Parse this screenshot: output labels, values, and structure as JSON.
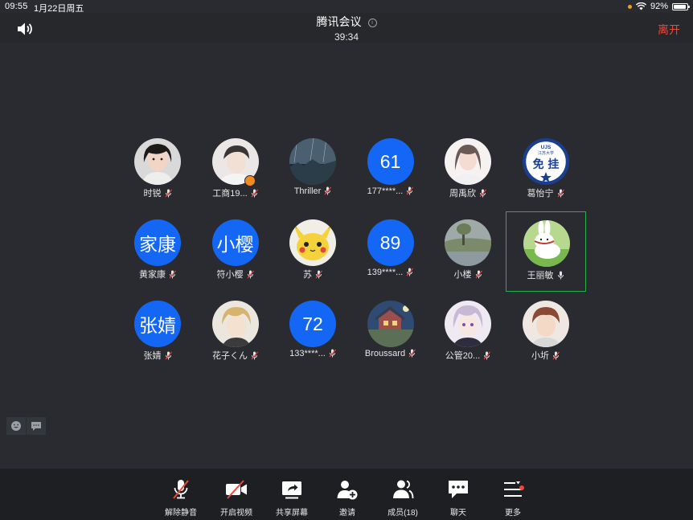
{
  "status_bar": {
    "time": "09:55",
    "date": "1月22日周五",
    "battery": "92%",
    "battery_level": 0.92
  },
  "header": {
    "title": "腾讯会议",
    "timer": "39:34",
    "leave_label": "离开"
  },
  "participants": [
    {
      "name": "时锐",
      "avatar_text": "",
      "avatar": "photo-girl"
    },
    {
      "name": "工商19...",
      "avatar_text": "",
      "avatar": "photo-boy",
      "host": true
    },
    {
      "name": "Thriller",
      "avatar_text": "",
      "avatar": "rain-scene"
    },
    {
      "name": "177****...",
      "avatar_text": "61",
      "avatar": "blue"
    },
    {
      "name": "周禹欣",
      "avatar_text": "",
      "avatar": "photo-girl2"
    },
    {
      "name": "葛怡宁",
      "avatar_text": "",
      "avatar": "badge-logo",
      "badge_lines": [
        "UJS",
        "江苏大学",
        "免 挂"
      ]
    },
    {
      "name": "黄家康",
      "avatar_text": "家康",
      "avatar": "blue"
    },
    {
      "name": "符小樱",
      "avatar_text": "小樱",
      "avatar": "blue"
    },
    {
      "name": "苏",
      "avatar_text": "",
      "avatar": "pikachu"
    },
    {
      "name": "139****...",
      "avatar_text": "89",
      "avatar": "blue"
    },
    {
      "name": "小楼",
      "avatar_text": "",
      "avatar": "landscape"
    },
    {
      "name": "王丽敏",
      "avatar_text": "",
      "avatar": "cartoon-bunny",
      "active": true,
      "mic_on": true
    },
    {
      "name": "张婧",
      "avatar_text": "张婧",
      "avatar": "blue"
    },
    {
      "name": "花子くん",
      "avatar_text": "",
      "avatar": "anime-blond"
    },
    {
      "name": "133****...",
      "avatar_text": "72",
      "avatar": "blue"
    },
    {
      "name": "Broussard",
      "avatar_text": "",
      "avatar": "house-painting"
    },
    {
      "name": "公管20...",
      "avatar_text": "",
      "avatar": "anime-purple"
    },
    {
      "name": "小圻",
      "avatar_text": "",
      "avatar": "anime-red"
    }
  ],
  "toolbar": [
    {
      "key": "unmute",
      "label": "解除静音",
      "icon": "mic-muted-icon"
    },
    {
      "key": "video",
      "label": "开启视频",
      "icon": "camera-off-icon"
    },
    {
      "key": "share",
      "label": "共享屏幕",
      "icon": "share-screen-icon"
    },
    {
      "key": "invite",
      "label": "邀请",
      "icon": "add-user-icon"
    },
    {
      "key": "members",
      "label": "成员(18)",
      "icon": "members-icon"
    },
    {
      "key": "chat",
      "label": "聊天",
      "icon": "chat-icon"
    },
    {
      "key": "more",
      "label": "更多",
      "icon": "menu-icon"
    }
  ],
  "colors": {
    "accent_blue": "#1467f5",
    "leave_red": "#f0463c",
    "active_green": "#23b04a",
    "background": "#292b30"
  }
}
